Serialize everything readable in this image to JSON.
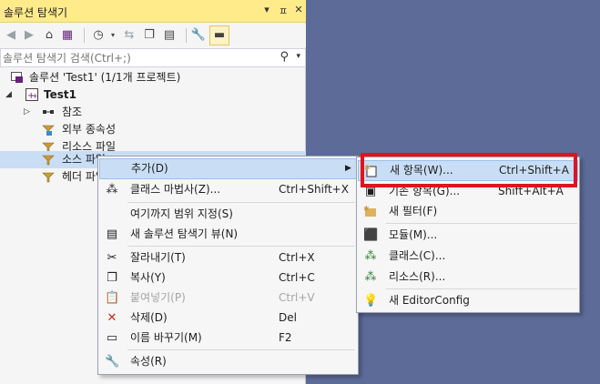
{
  "panel": {
    "title": "솔루션 탐색기",
    "title_buttons": [
      "▾",
      "ㅍ",
      "✕"
    ],
    "search_placeholder": "솔루션 탐색기 검색(Ctrl+;)"
  },
  "tree": {
    "solution": "솔루션 'Test1' (1/1개 프로젝트)",
    "project": "Test1",
    "items": [
      "참조",
      "외부 종속성",
      "리소스 파일",
      "소스 파일",
      "헤더 파일"
    ]
  },
  "context_menu": {
    "items": [
      {
        "label": "추가(D)",
        "shortcut": ""
      },
      {
        "label": "클래스 마법사(Z)...",
        "shortcut": "Ctrl+Shift+X"
      },
      {
        "label": "여기까지 범위 지정(S)",
        "shortcut": ""
      },
      {
        "label": "새 솔루션 탐색기 뷰(N)",
        "shortcut": ""
      },
      {
        "label": "잘라내기(T)",
        "shortcut": "Ctrl+X"
      },
      {
        "label": "복사(Y)",
        "shortcut": "Ctrl+C"
      },
      {
        "label": "붙여넣기(P)",
        "shortcut": "Ctrl+V"
      },
      {
        "label": "삭제(D)",
        "shortcut": "Del"
      },
      {
        "label": "이름 바꾸기(M)",
        "shortcut": "F2"
      },
      {
        "label": "속성(R)",
        "shortcut": ""
      }
    ]
  },
  "submenu": {
    "items": [
      {
        "label": "새 항목(W)...",
        "shortcut": "Ctrl+Shift+A"
      },
      {
        "label": "기존 항목(G)...",
        "shortcut": "Shift+Alt+A"
      },
      {
        "label": "새 필터(F)",
        "shortcut": ""
      },
      {
        "label": "모듈(M)...",
        "shortcut": ""
      },
      {
        "label": "클래스(C)...",
        "shortcut": ""
      },
      {
        "label": "리소스(R)...",
        "shortcut": ""
      },
      {
        "label": "새 EditorConfig",
        "shortcut": ""
      }
    ]
  },
  "colors": {
    "title_bar": "#ffeb8a",
    "highlight": "#c9def5",
    "annotation": "#e0141e",
    "background": "#5d6b99"
  }
}
